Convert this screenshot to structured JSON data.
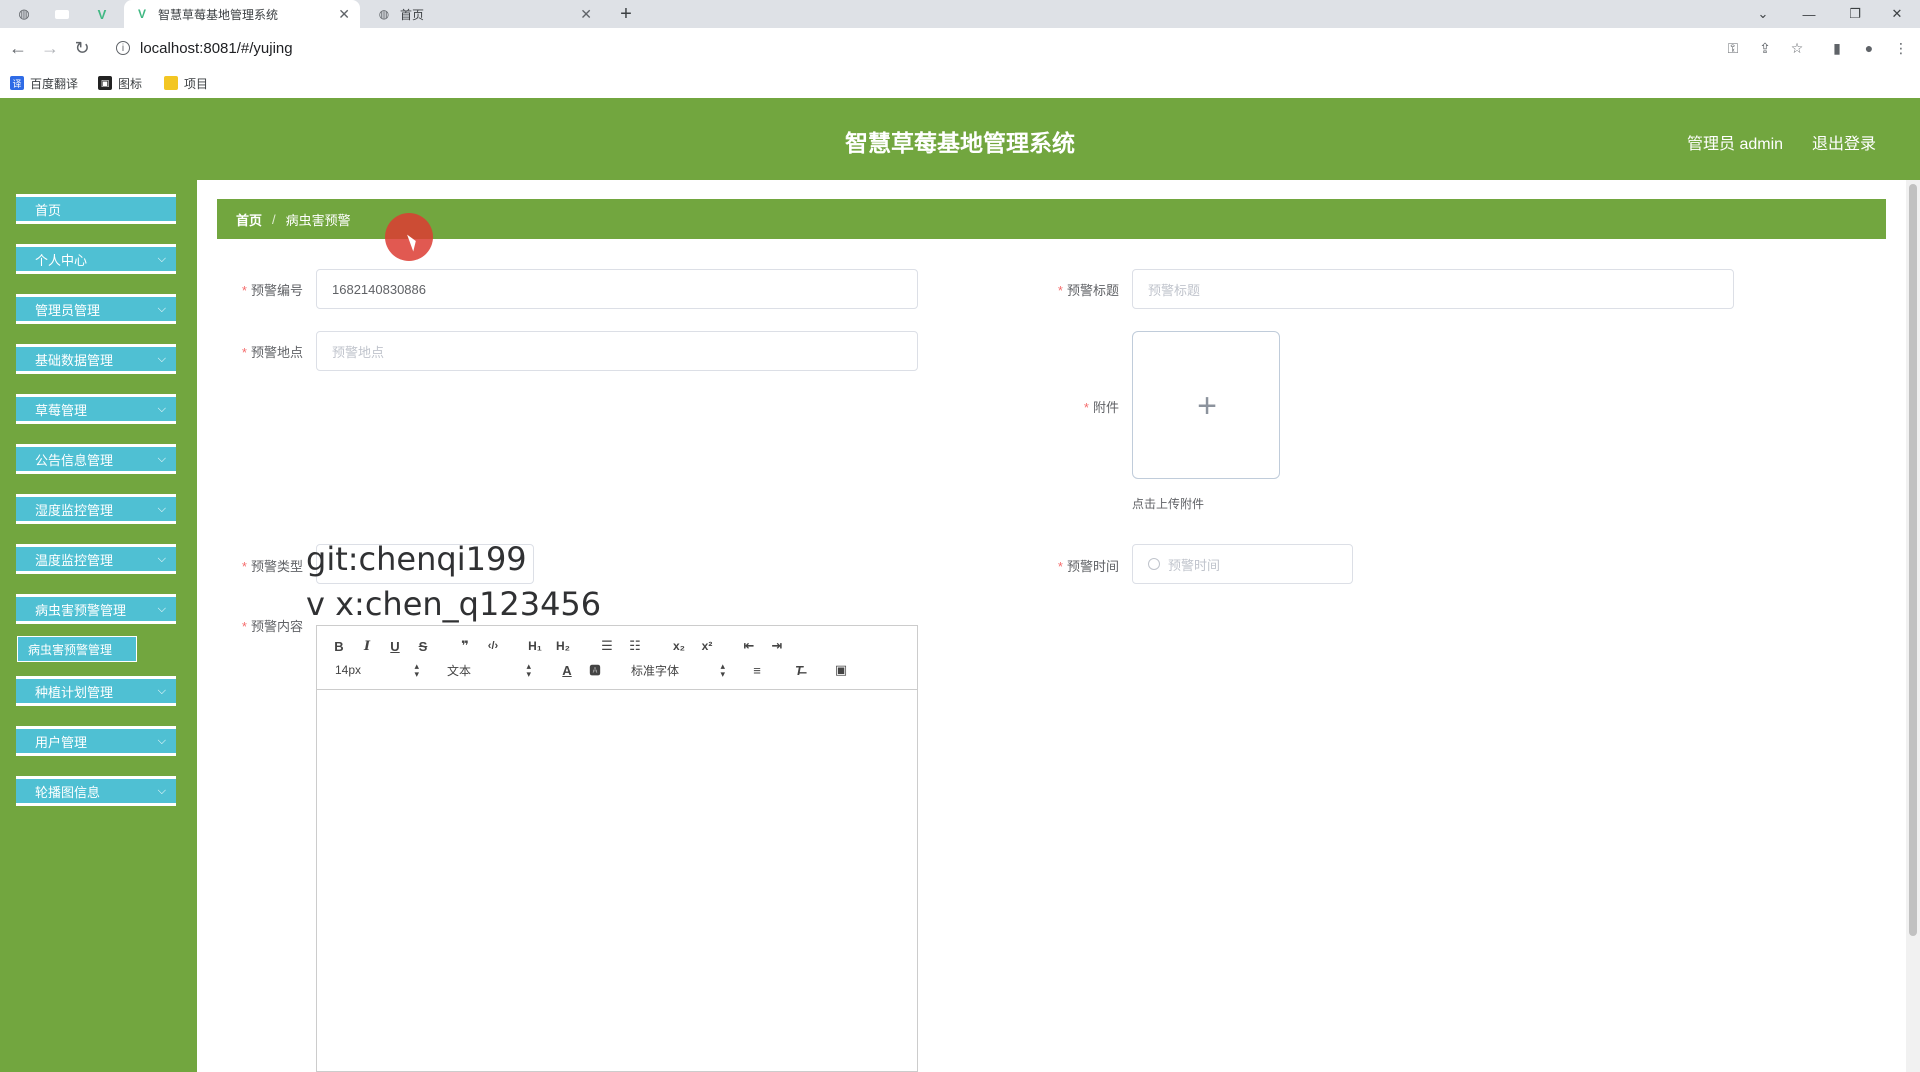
{
  "browser": {
    "tabs": [
      {
        "title": "智慧草莓基地管理系统",
        "active": true
      },
      {
        "title": "首页",
        "active": false
      }
    ],
    "url": "localhost:8081/#/yujing",
    "bookmarks": [
      "百度翻译",
      "图标",
      "项目"
    ]
  },
  "header": {
    "title": "智慧草莓基地管理系统",
    "user": "管理员 admin",
    "logout": "退出登录"
  },
  "sidebar": {
    "items": [
      {
        "label": "首页",
        "has_children": false
      },
      {
        "label": "个人中心",
        "has_children": true
      },
      {
        "label": "管理员管理",
        "has_children": true
      },
      {
        "label": "基础数据管理",
        "has_children": true
      },
      {
        "label": "草莓管理",
        "has_children": true
      },
      {
        "label": "公告信息管理",
        "has_children": true
      },
      {
        "label": "湿度监控管理",
        "has_children": true
      },
      {
        "label": "温度监控管理",
        "has_children": true
      },
      {
        "label": "病虫害预警管理",
        "has_children": true
      },
      {
        "label": "种植计划管理",
        "has_children": true
      },
      {
        "label": "用户管理",
        "has_children": true
      },
      {
        "label": "轮播图信息",
        "has_children": true
      }
    ],
    "submenu": "病虫害预警管理"
  },
  "breadcrumb": {
    "home": "首页",
    "separator": "/",
    "current": "病虫害预警"
  },
  "form": {
    "code_label": "预警编号",
    "code_value": "1682140830886",
    "title_label": "预警标题",
    "title_placeholder": "预警标题",
    "location_label": "预警地点",
    "location_placeholder": "预警地点",
    "attachment_label": "附件",
    "attachment_tip": "点击上传附件",
    "type_label": "预警类型",
    "time_label": "预警时间",
    "time_placeholder": "预警时间",
    "content_label": "预警内容"
  },
  "editor": {
    "font_size": "14px",
    "block_type": "文本",
    "font_family": "标准字体"
  },
  "watermark": {
    "line1": "git:chenqi199",
    "line2": "v x:chen_q123456"
  },
  "colors": {
    "header_green": "#72a63f",
    "menu_cyan": "#4fc0d3",
    "required_red": "#f56c6c"
  }
}
